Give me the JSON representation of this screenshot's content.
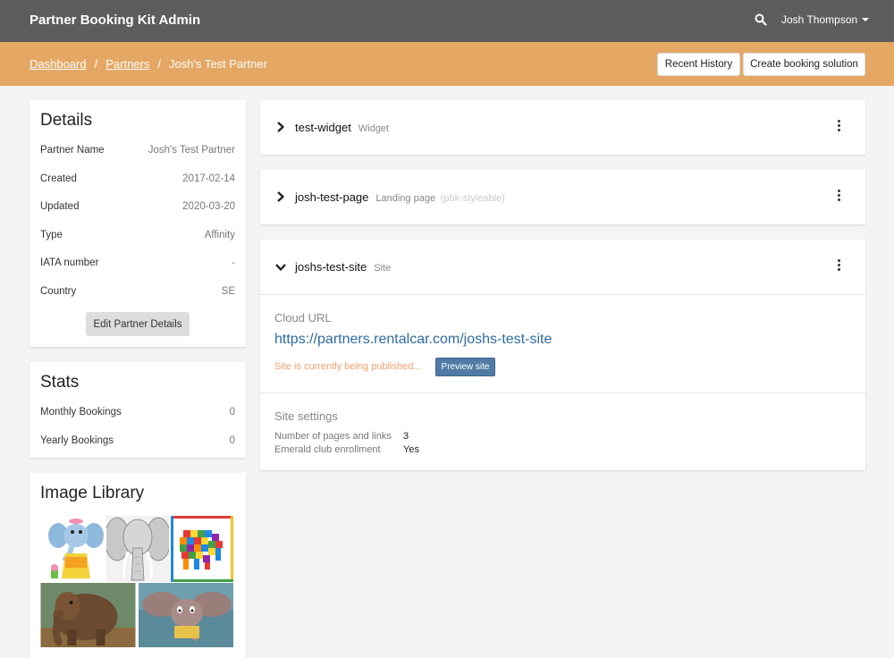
{
  "header": {
    "title": "Partner Booking Kit Admin",
    "user_name": "Josh Thompson"
  },
  "breadcrumb": {
    "items": [
      "Dashboard",
      "Partners"
    ],
    "current": "Josh's Test Partner",
    "separator": "/"
  },
  "actions": {
    "recent_history": "Recent History",
    "create_booking": "Create booking solution"
  },
  "details": {
    "title": "Details",
    "rows": [
      {
        "label": "Partner Name",
        "value": "Josh's Test Partner"
      },
      {
        "label": "Created",
        "value": "2017-02-14"
      },
      {
        "label": "Updated",
        "value": "2020-03-20"
      },
      {
        "label": "Type",
        "value": "Affinity"
      },
      {
        "label": "IATA number",
        "value": "-"
      },
      {
        "label": "Country",
        "value": "SE"
      }
    ],
    "edit_button": "Edit Partner Details"
  },
  "stats": {
    "title": "Stats",
    "rows": [
      {
        "label": "Monthly Bookings",
        "value": "0"
      },
      {
        "label": "Yearly Bookings",
        "value": "0"
      }
    ]
  },
  "image_library": {
    "title": "Image Library"
  },
  "widgets": [
    {
      "name": "test-widget",
      "type": "Widget",
      "extra": "",
      "expanded": false
    },
    {
      "name": "josh-test-page",
      "type": "Landing page",
      "extra": "(pbk-styleable)",
      "expanded": false
    },
    {
      "name": "joshs-test-site",
      "type": "Site",
      "extra": "",
      "expanded": true
    }
  ],
  "site_detail": {
    "cloud_url_label": "Cloud URL",
    "cloud_url": "https://partners.rentalcar.com/joshs-test-site",
    "publish_status": "Site is currently being published...",
    "preview_button": "Preview site",
    "settings_label": "Site settings",
    "settings": [
      {
        "label": "Number of pages and links",
        "value": "3"
      },
      {
        "label": "Emerald club enrollment",
        "value": "Yes"
      }
    ]
  },
  "colors": {
    "topbar": "#5d5d5d",
    "breadcrumb_bar": "#e5a764",
    "link": "#2e6ca3",
    "publish_status": "#f0a070",
    "preview_button": "#4f7ba4"
  }
}
